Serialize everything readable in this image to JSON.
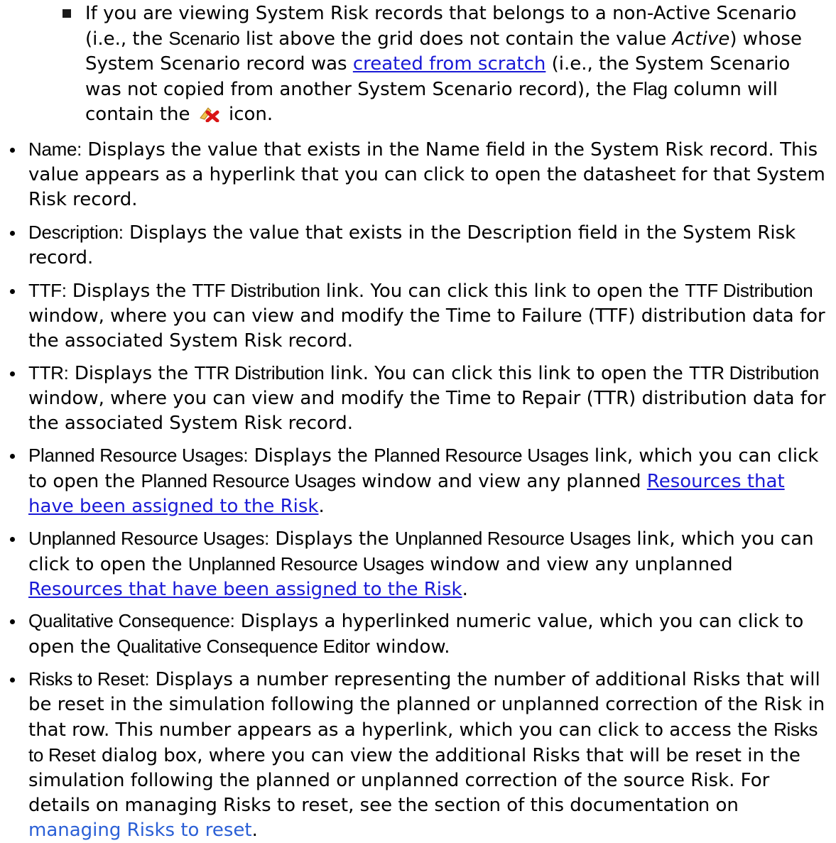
{
  "sub_item": {
    "t1": "If you are viewing System Risk records that belongs to a non-Active Scenario (i.e., the ",
    "b1": "Scenario",
    "t2": " list above the grid does not contain the value ",
    "i1": "Active",
    "t3": ") whose System Scenario record was ",
    "link1": "created from scratch",
    "t4": " (i.e., the System Scenario was not copied from another System Scenario record), the ",
    "b2": "Flag",
    "t5": " column will contain the ",
    "icon": "flag-red-x-icon",
    "t6": " icon."
  },
  "items": {
    "name": {
      "label": "Name:",
      "text": " Displays the value that exists in the Name field in the System Risk record. This value appears as a hyperlink that you can click to open the datasheet for that System Risk record."
    },
    "description": {
      "label": "Description:",
      "text": " Displays the value that exists in the Description field in the System Risk record."
    },
    "ttf": {
      "label": "TTF:",
      "t1": " Displays the ",
      "b1": "TTF Distribution",
      "t2": " link. You can click this link to open the ",
      "b2": "TTF Dis­tribution",
      "t3": " window, where you can view and modify the Time to Failure (TTF) dis­tribution data for the associated System Risk record."
    },
    "ttr": {
      "label": "TTR:",
      "t1": " Displays the ",
      "b1": "TTR Distribution",
      "t2": " link. You can click this link to open the ",
      "b2": "TTR Dis­tribution",
      "t3": " window, where you can view and modify the Time to Repair (TTR) dis­tribution data for the associated System Risk record."
    },
    "planned": {
      "label": "Planned Resource Usages:",
      "t1": " Displays the ",
      "b1": "Planned Resource Usages",
      "t2": " link, which you can click to open the ",
      "b2": "Planned Resource Usages",
      "t3": " window and view any planned ",
      "link": "Resources that have been assigned to the Risk",
      "t4": "."
    },
    "unplanned": {
      "label": "Unplanned Resource Usages:",
      "t1": " Displays the ",
      "b1": "Unplanned Resource Usages",
      "t2": " link, which you can click to open the ",
      "b2": "Unplanned Resource Usages",
      "t3": " window and view any unplanned ",
      "link": "Resources that have been assigned to the Risk",
      "t4": "."
    },
    "qualitative": {
      "label": "Qualitative Consequence:",
      "t1": " Displays a hyperlinked numeric value, which you can click to open the ",
      "b1": "Qualitative Consequence Editor",
      "t2": " window."
    },
    "risks_reset": {
      "label": "Risks to Reset:",
      "t1": " Displays a number representing the number of additional Risks that will be reset in the simulation following the planned or unplanned correction of the Risk in that row. This number appears as a hyperlink, which you can click to access the ",
      "b1": "Risks to Reset",
      "t2": " dialog box, where you can view the additional Risks that will be reset in the simulation following the planned or unplanned correction of the source Risk. For details on managing Risks to reset, see the section of this doc­umentation on ",
      "link": "managing Risks to reset",
      "t3": "."
    }
  }
}
